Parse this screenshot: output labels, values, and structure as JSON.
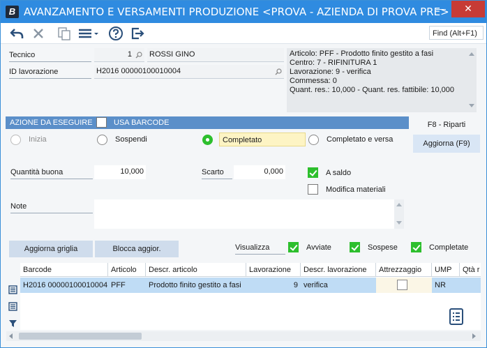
{
  "window": {
    "app_icon_letter": "B",
    "title": "AVANZAMENTO E VERSAMENTI PRODUZIONE <PROVA - AZIENDA DI PROVA PRE>",
    "minimize_glyph": "—",
    "close_glyph": "✕"
  },
  "toolbar": {
    "find_label": "Find (Alt+F1)",
    "icons": [
      "undo-icon",
      "cancel-icon",
      "copy-icon",
      "menu-icon",
      "help-icon",
      "exit-icon"
    ]
  },
  "header": {
    "tecnico_label": "Tecnico",
    "tecnico_code": "1",
    "tecnico_name": "ROSSI GINO",
    "id_lavorazione_label": "ID lavorazione",
    "id_lavorazione_value": "H2016 00000100010004"
  },
  "info": {
    "lines": [
      "Articolo: PFF - Prodotto finito gestito a fasi",
      "Centro: 7 - RIFINITURA 1",
      "Lavorazione: 9 - verifica",
      "Commessa: 0",
      "Quant. res.: 10,000 - Quant. res. fattibile: 10,000"
    ]
  },
  "azione": {
    "section_label": "AZIONE DA ESEGUIRE",
    "usa_barcode_label": "USA BARCODE",
    "options": {
      "inizia": "Inizia",
      "sospendi": "Sospendi",
      "completato": "Completato",
      "completato_versa": "Completato e versa"
    },
    "selected": "completato"
  },
  "side_buttons": {
    "riparti": "F8 - Riparti",
    "aggiorna": "Aggiorna (F9)"
  },
  "quantities": {
    "quantita_buona_label": "Quantità buona",
    "quantita_buona_value": "10,000",
    "scarto_label": "Scarto",
    "scarto_value": "0,000",
    "a_saldo_label": "A saldo",
    "modifica_materiali_label": "Modifica materiali"
  },
  "note": {
    "label": "Note",
    "value": ""
  },
  "grid_controls": {
    "aggiorna_griglia": "Aggiorna griglia",
    "blocca_aggior": "Blocca aggior.",
    "visualizza_label": "Visualizza",
    "avviate_label": "Avviate",
    "sospese_label": "Sospese",
    "completate_label": "Completate"
  },
  "grid": {
    "columns": [
      "Barcode",
      "Articolo",
      "Descr. articolo",
      "Lavorazione",
      "Descr. lavorazione",
      "Attrezzaggio",
      "UMP",
      "Qtà r"
    ],
    "rows": [
      {
        "barcode": "H2016 00000100010004",
        "articolo": "PFF",
        "descr_articolo": "Prodotto finito gestito a fasi",
        "lavorazione": "9",
        "descr_lavorazione": "verifica",
        "attrezzaggio": false,
        "ump": "NR",
        "qta": ""
      }
    ]
  },
  "colors": {
    "titlebar": "#2f8be0",
    "section_bar": "#5b8fc9",
    "check_green": "#2dbf2d",
    "selected_row": "#bfdcf5",
    "highlight_field": "#fdf4c4"
  }
}
